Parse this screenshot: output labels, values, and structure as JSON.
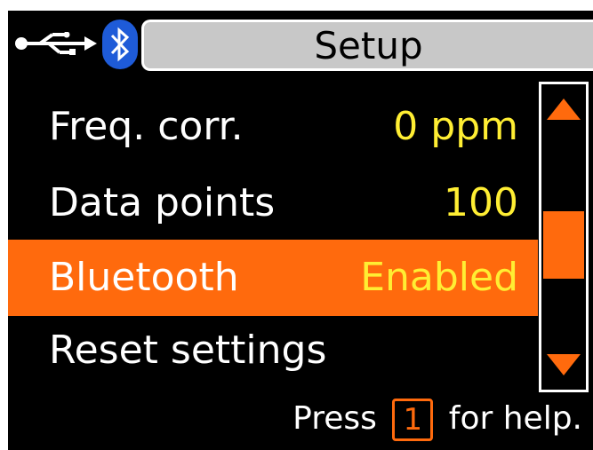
{
  "header": {
    "title": "Setup",
    "status_icons": [
      "usb-icon",
      "bluetooth-icon"
    ]
  },
  "menu": {
    "items": [
      {
        "label": "Freq. corr.",
        "value": "0 ppm",
        "selected": false
      },
      {
        "label": "Data points",
        "value": "100",
        "selected": false
      },
      {
        "label": "Bluetooth",
        "value": "Enabled",
        "selected": true
      },
      {
        "label": "Reset settings",
        "value": "",
        "selected": false
      }
    ]
  },
  "scrollbar": {
    "position_fraction": 0.55,
    "thumb_fraction": 0.22
  },
  "footer": {
    "prefix": "Press",
    "key": "1",
    "suffix": "for help."
  },
  "colors": {
    "accent": "#ff6a0d",
    "value_text": "#ffee33",
    "title_bar": "#c8c8c8",
    "background": "#000000",
    "bluetooth": "#1e5bd8"
  }
}
